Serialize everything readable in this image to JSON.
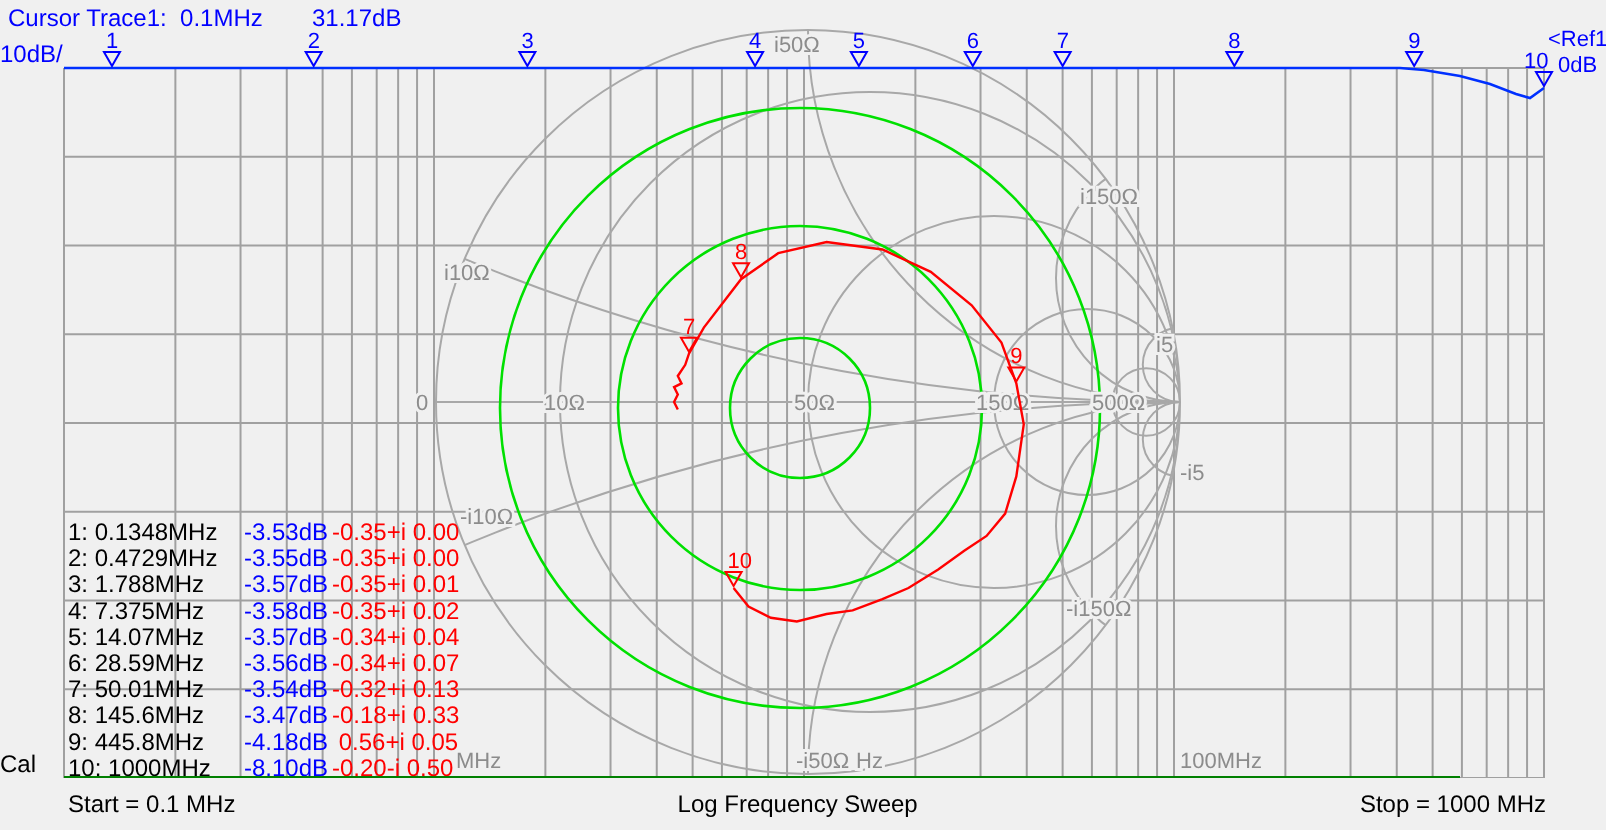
{
  "cursor": {
    "label": "Cursor Trace1:  0.1MHz",
    "value": "31.17dB"
  },
  "scale": "10dB/",
  "reference": {
    "label": "<Ref1",
    "value": "0dB"
  },
  "trace_markers": [
    {
      "label": "1"
    },
    {
      "label": "2"
    },
    {
      "label": "3"
    },
    {
      "label": "4"
    },
    {
      "label": "5"
    },
    {
      "label": "6"
    },
    {
      "label": "7"
    },
    {
      "label": "8"
    },
    {
      "label": "9"
    },
    {
      "label": "10"
    }
  ],
  "smith_labels": [
    "0",
    "10Ω",
    "50Ω",
    "150Ω",
    "500Ω",
    "i10Ω",
    "-i10Ω",
    "i50Ω",
    "-i50Ω",
    "i150Ω",
    "-i150Ω",
    "i5",
    "-i5"
  ],
  "smith_markers": [
    {
      "label": "7"
    },
    {
      "label": "8"
    },
    {
      "label": "9"
    },
    {
      "label": "10"
    }
  ],
  "frequency_labels": [
    "MHz",
    "Hz",
    "100MHz"
  ],
  "marker_table": [
    {
      "frequency": "1: 0.1348MHz",
      "magnitude": "-3.53dB",
      "impedance": "-0.35+i 0.00"
    },
    {
      "frequency": "2: 0.4729MHz",
      "magnitude": "-3.55dB",
      "impedance": "-0.35+i 0.00"
    },
    {
      "frequency": "3: 1.788MHz",
      "magnitude": "-3.57dB",
      "impedance": "-0.35+i 0.01"
    },
    {
      "frequency": "4: 7.375MHz",
      "magnitude": "-3.58dB",
      "impedance": "-0.35+i 0.02"
    },
    {
      "frequency": "5: 14.07MHz",
      "magnitude": "-3.57dB",
      "impedance": "-0.34+i 0.04"
    },
    {
      "frequency": "6: 28.59MHz",
      "magnitude": "-3.56dB",
      "impedance": "-0.34+i 0.07"
    },
    {
      "frequency": "7: 50.01MHz",
      "magnitude": "-3.54dB",
      "impedance": "-0.32+i 0.13"
    },
    {
      "frequency": "8: 145.6MHz",
      "magnitude": "-3.47dB",
      "impedance": "-0.18+i 0.33"
    },
    {
      "frequency": "9: 445.8MHz",
      "magnitude": "-4.18dB",
      "impedance": " 0.56+i 0.05"
    },
    {
      "frequency": "10: 1000MHz",
      "magnitude": "-8.10dB",
      "impedance": "-0.20-i 0.50"
    }
  ],
  "cal": "Cal",
  "footer": {
    "start": "Start = 0.1 MHz",
    "mode": "Log Frequency Sweep",
    "stop": "Stop = 1000 MHz"
  }
}
